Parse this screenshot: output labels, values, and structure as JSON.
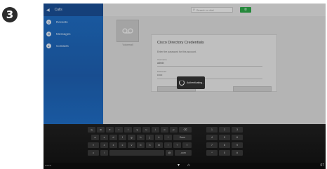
{
  "step_number": "3",
  "sidebar": {
    "title": "Calls",
    "items": [
      {
        "label": "Recents",
        "icon": "clock-icon"
      },
      {
        "label": "Messages",
        "icon": "message-icon"
      },
      {
        "label": "Contacts",
        "icon": "person-icon"
      }
    ]
  },
  "topbar": {
    "search_placeholder": "Search or dial",
    "call_button_icon": "phone-icon"
  },
  "voicemail": {
    "label": "Voicemail"
  },
  "dialog": {
    "title": "Cisco Directory Credentials",
    "description": "Enter the password for this account.",
    "username_label": "Username",
    "username_value": "admin",
    "password_label": "Password",
    "password_value": "••••••"
  },
  "overlay": {
    "text": "Authenticating..."
  },
  "keyboard": {
    "row1": [
      "q",
      "w",
      "e",
      "r",
      "t",
      "y",
      "u",
      "i",
      "o",
      "p",
      "⌫"
    ],
    "row2": [
      "a",
      "s",
      "d",
      "f",
      "g",
      "h",
      "j",
      "k",
      "l",
      "Done"
    ],
    "row3": [
      "⇧",
      "z",
      "x",
      "c",
      "v",
      "b",
      "n",
      "m",
      "!",
      "?",
      "⇧"
    ],
    "row4": [
      "☺",
      "/",
      "",
      "@",
      ".com"
    ],
    "numpad": [
      [
        "1",
        "2",
        "3"
      ],
      [
        "4",
        "5",
        "6"
      ],
      [
        "7",
        "8",
        "9"
      ],
      [
        "*",
        "0",
        "#"
      ]
    ]
  },
  "navbar": {
    "left_text": "Hitachi",
    "back_icon": "▾",
    "home_icon": "⌂",
    "clock": "07"
  },
  "colors": {
    "sidebar": "#1f6fc5",
    "call_button": "#2fa84a"
  }
}
